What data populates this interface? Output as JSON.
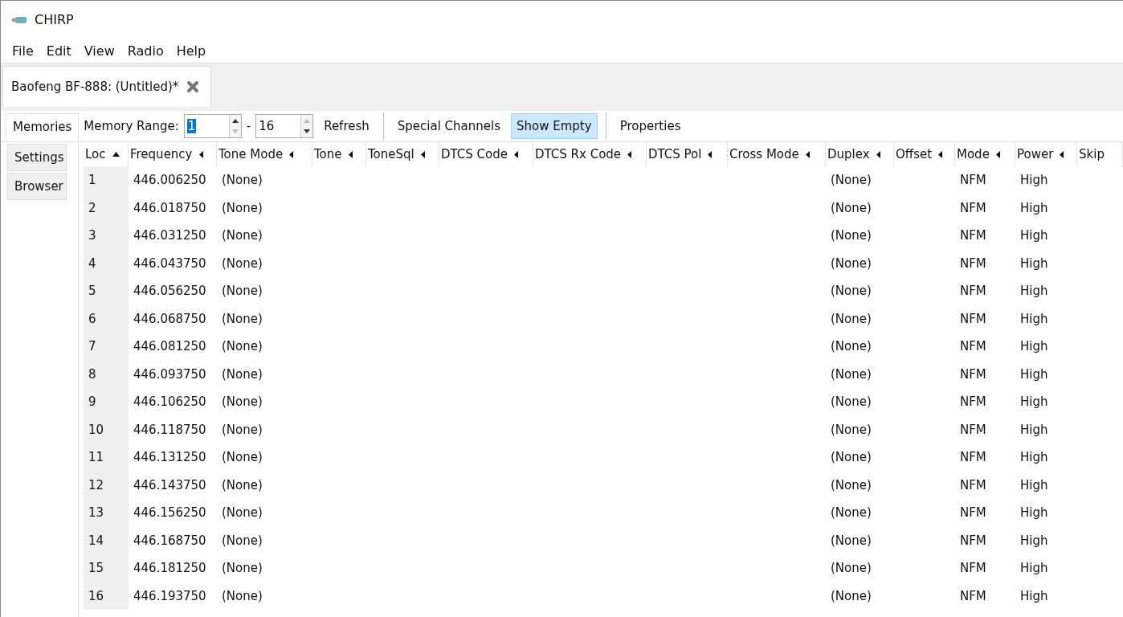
{
  "window": {
    "title": "CHIRP"
  },
  "menu": [
    "File",
    "Edit",
    "View",
    "Radio",
    "Help"
  ],
  "tabs": [
    {
      "label": "Baofeng BF-888: (Untitled)*",
      "selected": true
    }
  ],
  "side_tabs": [
    {
      "label": "Memories",
      "selected": true
    },
    {
      "label": "Settings",
      "selected": false
    },
    {
      "label": "Browser",
      "selected": false
    }
  ],
  "toolbar": {
    "range_label": "Memory Range:",
    "range_start": "1",
    "range_sep": "-",
    "range_end": "16",
    "refresh": "Refresh",
    "toggles": [
      {
        "label": "Special Channels",
        "selected": false
      },
      {
        "label": "Show Empty",
        "selected": true
      }
    ],
    "properties": "Properties"
  },
  "columns": [
    {
      "label": "Loc",
      "kind": "sorted"
    },
    {
      "label": "Frequency",
      "kind": "sortable"
    },
    {
      "label": "Tone Mode",
      "kind": "sortable"
    },
    {
      "label": "Tone",
      "kind": "sortable"
    },
    {
      "label": "ToneSql",
      "kind": "sortable"
    },
    {
      "label": "DTCS Code",
      "kind": "sortable"
    },
    {
      "label": "DTCS Rx Code",
      "kind": "sortable"
    },
    {
      "label": "DTCS Pol",
      "kind": "sortable"
    },
    {
      "label": "Cross Mode",
      "kind": "sortable"
    },
    {
      "label": "Duplex",
      "kind": "sortable"
    },
    {
      "label": "Offset",
      "kind": "sortable"
    },
    {
      "label": "Mode",
      "kind": "sortable"
    },
    {
      "label": "Power",
      "kind": "sortable"
    },
    {
      "label": "Skip",
      "kind": "plain"
    }
  ],
  "rows": [
    {
      "loc": "1",
      "frequency": "446.006250",
      "tone_mode": "(None)",
      "duplex": "(None)",
      "mode": "NFM",
      "power": "High"
    },
    {
      "loc": "2",
      "frequency": "446.018750",
      "tone_mode": "(None)",
      "duplex": "(None)",
      "mode": "NFM",
      "power": "High"
    },
    {
      "loc": "3",
      "frequency": "446.031250",
      "tone_mode": "(None)",
      "duplex": "(None)",
      "mode": "NFM",
      "power": "High"
    },
    {
      "loc": "4",
      "frequency": "446.043750",
      "tone_mode": "(None)",
      "duplex": "(None)",
      "mode": "NFM",
      "power": "High"
    },
    {
      "loc": "5",
      "frequency": "446.056250",
      "tone_mode": "(None)",
      "duplex": "(None)",
      "mode": "NFM",
      "power": "High"
    },
    {
      "loc": "6",
      "frequency": "446.068750",
      "tone_mode": "(None)",
      "duplex": "(None)",
      "mode": "NFM",
      "power": "High"
    },
    {
      "loc": "7",
      "frequency": "446.081250",
      "tone_mode": "(None)",
      "duplex": "(None)",
      "mode": "NFM",
      "power": "High"
    },
    {
      "loc": "8",
      "frequency": "446.093750",
      "tone_mode": "(None)",
      "duplex": "(None)",
      "mode": "NFM",
      "power": "High"
    },
    {
      "loc": "9",
      "frequency": "446.106250",
      "tone_mode": "(None)",
      "duplex": "(None)",
      "mode": "NFM",
      "power": "High"
    },
    {
      "loc": "10",
      "frequency": "446.118750",
      "tone_mode": "(None)",
      "duplex": "(None)",
      "mode": "NFM",
      "power": "High"
    },
    {
      "loc": "11",
      "frequency": "446.131250",
      "tone_mode": "(None)",
      "duplex": "(None)",
      "mode": "NFM",
      "power": "High"
    },
    {
      "loc": "12",
      "frequency": "446.143750",
      "tone_mode": "(None)",
      "duplex": "(None)",
      "mode": "NFM",
      "power": "High"
    },
    {
      "loc": "13",
      "frequency": "446.156250",
      "tone_mode": "(None)",
      "duplex": "(None)",
      "mode": "NFM",
      "power": "High"
    },
    {
      "loc": "14",
      "frequency": "446.168750",
      "tone_mode": "(None)",
      "duplex": "(None)",
      "mode": "NFM",
      "power": "High"
    },
    {
      "loc": "15",
      "frequency": "446.181250",
      "tone_mode": "(None)",
      "duplex": "(None)",
      "mode": "NFM",
      "power": "High"
    },
    {
      "loc": "16",
      "frequency": "446.193750",
      "tone_mode": "(None)",
      "duplex": "(None)",
      "mode": "NFM",
      "power": "High"
    }
  ]
}
